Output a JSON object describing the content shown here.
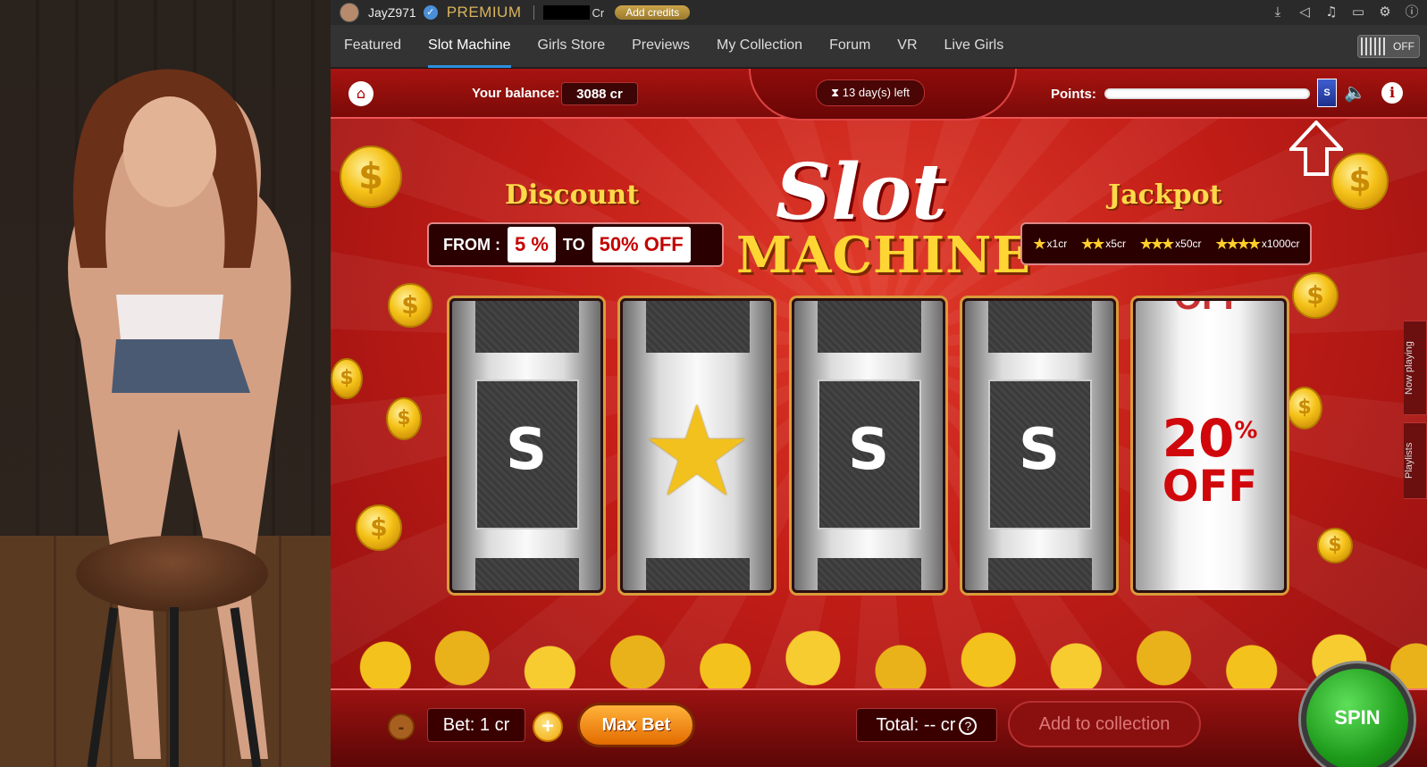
{
  "topbar": {
    "username": "JayZ971",
    "premium_label": "PREMIUM",
    "credits_suffix": "Cr",
    "add_credits_label": "Add credits",
    "icons": [
      "download-icon",
      "announce-icon",
      "music-icon",
      "monitor-icon",
      "gear-icon",
      "info-icon"
    ]
  },
  "nav": {
    "items": [
      "Featured",
      "Slot Machine",
      "Girls Store",
      "Previews",
      "My Collection",
      "Forum",
      "VR",
      "Live Girls"
    ],
    "active": "Slot Machine",
    "toggle_label": "OFF"
  },
  "game": {
    "balance_label": "Your balance:",
    "balance_value": "3088 cr",
    "days_left": "13 day(s) left",
    "points_label": "Points:",
    "points_badge": "S",
    "discount_title": "Discount",
    "discount_from_label": "FROM :",
    "discount_from_value": "5 %",
    "discount_to_label": "TO",
    "discount_to_value": "50% OFF",
    "title_line1": "Slot",
    "title_line2": "MACHINE",
    "jackpot_title": "Jackpot",
    "jackpot": [
      {
        "stars": "★",
        "label": "x1cr"
      },
      {
        "stars": "★★",
        "label": "x5cr"
      },
      {
        "stars": "★★★",
        "label": "x50cr"
      },
      {
        "stars": "★★★★",
        "label": "x1000cr"
      }
    ],
    "reels": [
      "S",
      "★",
      "S",
      "S"
    ],
    "reel5_pct": "20",
    "reel5_pct_sign": "%",
    "reel5_off": "OFF",
    "reel5_ghost": "OFF",
    "side_tabs": [
      "Now playing",
      "Playlists"
    ],
    "bet_label": "Bet: 1 cr",
    "minus_label": "-",
    "plus_label": "+",
    "max_bet_label": "Max Bet",
    "total_label": "Total: -- cr",
    "total_help": "?",
    "add_collection_label": "Add to collection",
    "spin_label": "SPIN"
  },
  "colors": {
    "accent_blue": "#2f8fdd",
    "game_red": "#c21d17",
    "gold": "#ffd633",
    "spin_green": "#1e9a1a"
  }
}
